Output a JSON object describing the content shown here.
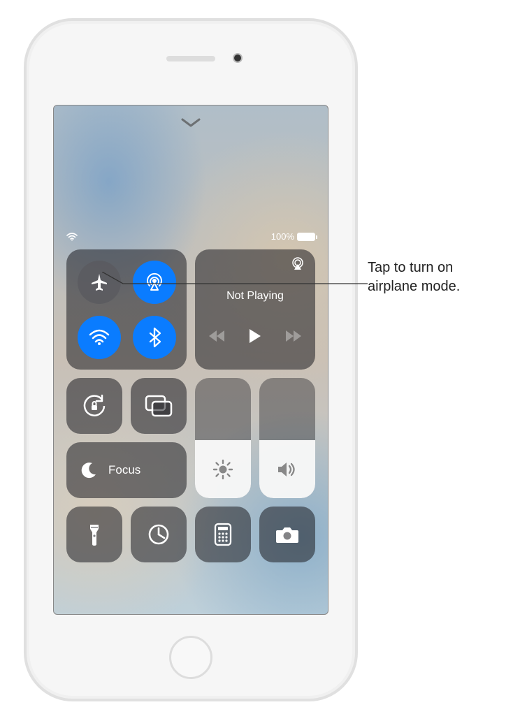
{
  "callout": "Tap to turn on airplane mode.",
  "status": {
    "battery_percent": "100%"
  },
  "connectivity": {
    "airplane_on": false,
    "airdrop_on": true,
    "wifi_on": true,
    "bluetooth_on": true
  },
  "media": {
    "title": "Not Playing"
  },
  "focus": {
    "label": "Focus"
  },
  "sliders": {
    "brightness_percent": 48,
    "volume_percent": 48
  }
}
